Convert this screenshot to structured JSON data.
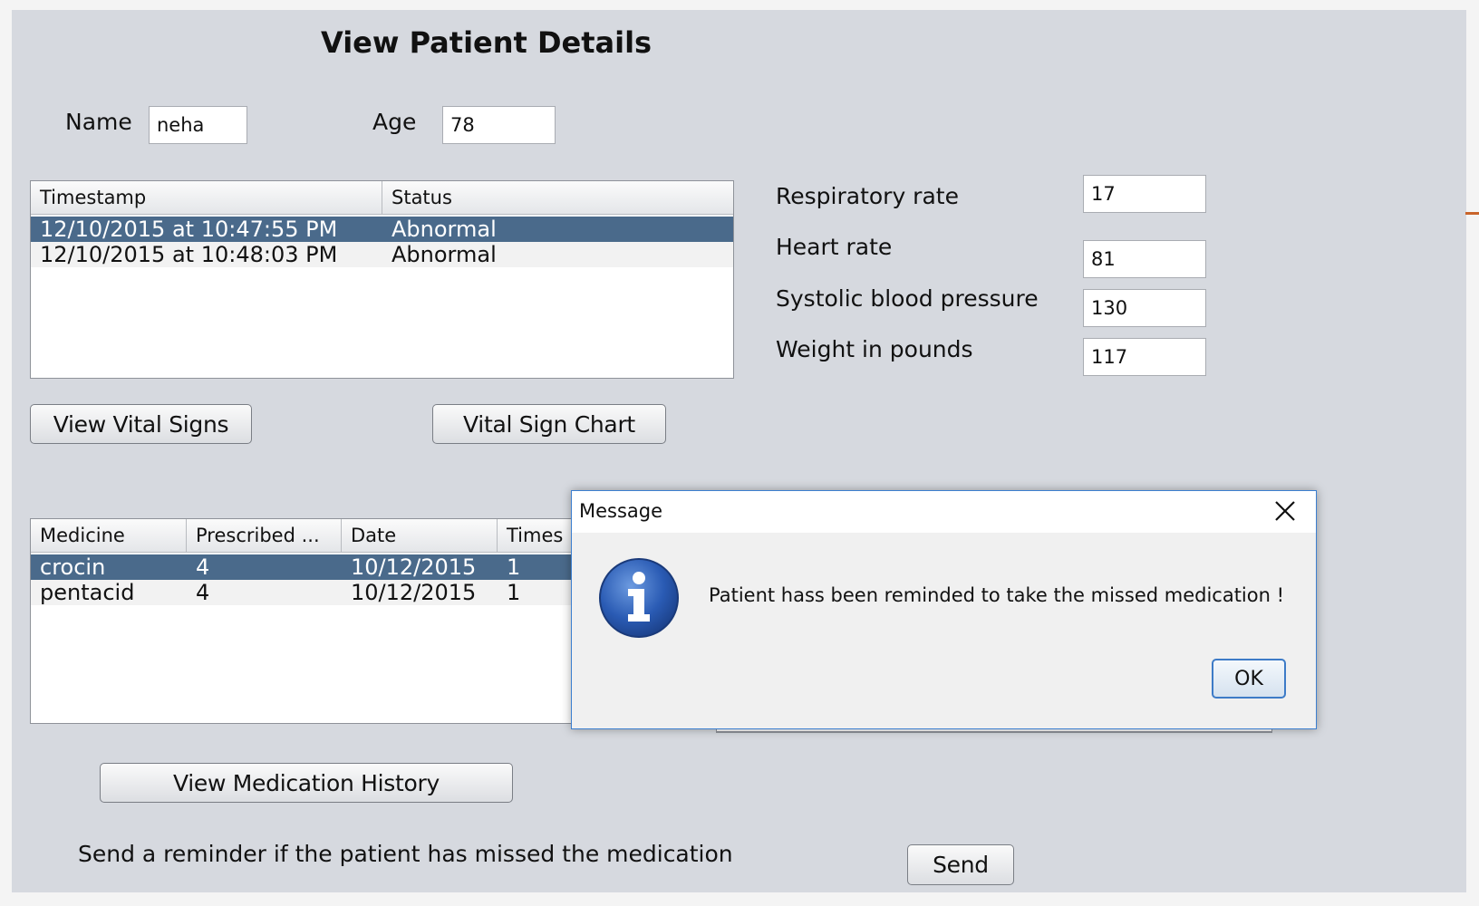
{
  "window": {
    "title": "View Patient Details"
  },
  "patient": {
    "name_label": "Name",
    "name_value": "neha",
    "age_label": "Age",
    "age_value": "78"
  },
  "vitals_table": {
    "columns": [
      "Timestamp",
      "Status"
    ],
    "rows": [
      [
        "12/10/2015 at 10:47:55 PM",
        "Abnormal"
      ],
      [
        "12/10/2015 at 10:48:03 PM",
        "Abnormal"
      ]
    ],
    "selected_row": 0
  },
  "vitals": {
    "respiratory_label": "Respiratory rate",
    "respiratory_value": "17",
    "heart_label": "Heart rate",
    "heart_value": "81",
    "systolic_label": "Systolic blood pressure",
    "systolic_value": "130",
    "weight_label": "Weight in pounds",
    "weight_value": "117"
  },
  "buttons": {
    "view_vital_signs": "View Vital Signs",
    "vital_sign_chart": "Vital Sign Chart",
    "view_medication_history": "View Medication History",
    "send": "Send"
  },
  "medication_table": {
    "columns": [
      "Medicine",
      "Prescribed ...",
      "Date",
      "Times"
    ],
    "rows": [
      [
        "crocin",
        "4",
        "10/12/2015",
        "1"
      ],
      [
        "pentacid",
        "4",
        "10/12/2015",
        "1"
      ]
    ],
    "selected_row": 0
  },
  "reminder_text": "Send a reminder if the patient has missed the medication",
  "dialog": {
    "title": "Message",
    "message": "Patient hass been reminded to take the missed medication !",
    "ok_label": "OK",
    "icon": "info-icon",
    "close_icon": "close-icon"
  },
  "colors": {
    "panel": "#d6d9df",
    "selection": "#4a6a8b",
    "dialog_border": "#3c7fd0",
    "info_icon": "#2a5bb4"
  }
}
